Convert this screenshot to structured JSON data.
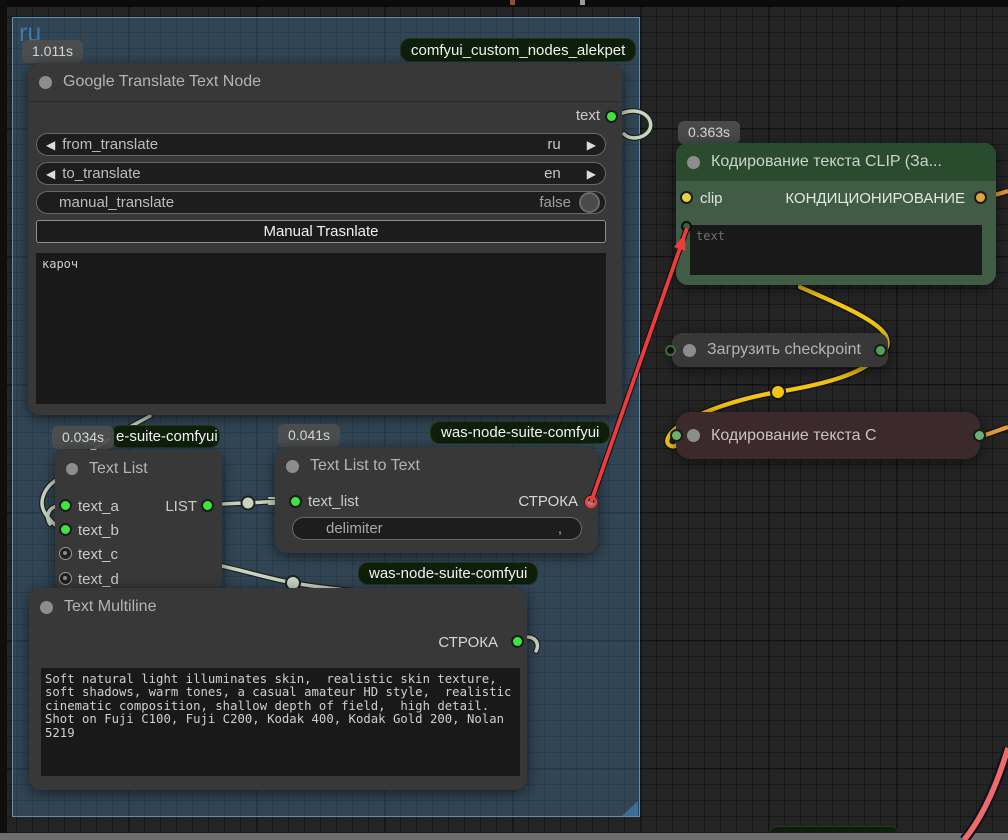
{
  "group": {
    "title": "ru"
  },
  "nodes": {
    "google": {
      "time": "1.011s",
      "repo": "comfyui_custom_nodes_alekpet",
      "title": "Google Translate Text Node",
      "output": "text",
      "from_label": "from_translate",
      "from_value": "ru",
      "to_label": "to_translate",
      "to_value": "en",
      "manual_label": "manual_translate",
      "manual_value": "false",
      "button": "Manual Trasnlate",
      "text": "кароч"
    },
    "clip": {
      "time": "0.363s",
      "title": "Кодирование текста CLIP (За...",
      "input": "clip",
      "output": "КОНДИЦИОНИРОВАНИЕ",
      "placeholder": "text"
    },
    "checkpoint": {
      "title": "Загрузить checkpoint"
    },
    "negative": {
      "title": "Кодирование текста C"
    },
    "textlist": {
      "time": "0.034s",
      "repo": "e-suite-comfyui",
      "title": "Text List",
      "inputs": [
        "text_a",
        "text_b",
        "text_c",
        "text_d"
      ],
      "output": "LIST"
    },
    "tl2t": {
      "time": "0.041s",
      "repo": "was-node-suite-comfyui",
      "title": "Text List to Text",
      "input": "text_list",
      "output": "СТРОКА",
      "delimiter_label": "delimiter",
      "delimiter_value": ","
    },
    "multiline": {
      "repo": "was-node-suite-comfyui",
      "title": "Text Multiline",
      "output": "СТРОКА",
      "text": "Soft natural light illuminates skin,  realistic skin texture,\nsoft shadows, warm tones, a casual amateur HD style,  realistic\ncinematic composition, shallow depth of field,  high detail.\nShot on Fuji C100, Fuji C200, Kodak 400, Kodak Gold 200, Nolan\n5219"
    }
  },
  "colors": {
    "group_fill": "#508ab6",
    "wire_pale": "#c9d3c2",
    "wire_yellow": "#f3c515",
    "wire_orange": "#e39a3b",
    "wire_red": "#ee3b3b",
    "wire_pink": "#ef6b6b",
    "port_green": "#3fe43f",
    "port_yellow": "#ecd23d",
    "port_orange": "#e2a33c"
  }
}
